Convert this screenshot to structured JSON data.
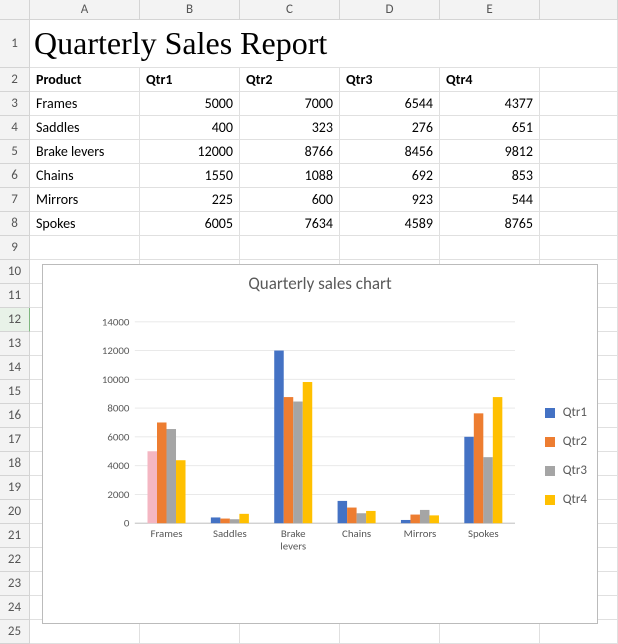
{
  "columns": [
    "A",
    "B",
    "C",
    "D",
    "E"
  ],
  "rows_total": 25,
  "selected_row_header": 12,
  "title_cell": "Quarterly Sales Report",
  "table": {
    "header": [
      "Product",
      "Qtr1",
      "Qtr2",
      "Qtr3",
      "Qtr4"
    ],
    "rows": [
      [
        "Frames",
        5000,
        7000,
        6544,
        4377
      ],
      [
        "Saddles",
        400,
        323,
        276,
        651
      ],
      [
        "Brake levers",
        12000,
        8766,
        8456,
        9812
      ],
      [
        "Chains",
        1550,
        1088,
        692,
        853
      ],
      [
        "Mirrors",
        225,
        600,
        923,
        544
      ],
      [
        "Spokes",
        6005,
        7634,
        4589,
        8765
      ]
    ]
  },
  "chart_data": {
    "type": "bar",
    "title": "Quarterly sales chart",
    "categories": [
      "Frames",
      "Saddles",
      "Brake levers",
      "Chains",
      "Mirrors",
      "Spokes"
    ],
    "series": [
      {
        "name": "Qtr1",
        "color": "#4472C4",
        "values": [
          5000,
          400,
          12000,
          1550,
          225,
          6005
        ]
      },
      {
        "name": "Qtr2",
        "color": "#ED7D31",
        "values": [
          7000,
          323,
          8766,
          1088,
          600,
          7634
        ]
      },
      {
        "name": "Qtr3",
        "color": "#A5A5A5",
        "values": [
          6544,
          276,
          8456,
          692,
          923,
          4589
        ]
      },
      {
        "name": "Qtr4",
        "color": "#FFC000",
        "values": [
          4377,
          651,
          9812,
          853,
          544,
          8765
        ]
      }
    ],
    "ylim": [
      0,
      14000
    ],
    "ytick_step": 2000,
    "highlight": {
      "series": 0,
      "category": 0,
      "color": "#F4B6C2"
    },
    "xlabel": "",
    "ylabel": ""
  }
}
